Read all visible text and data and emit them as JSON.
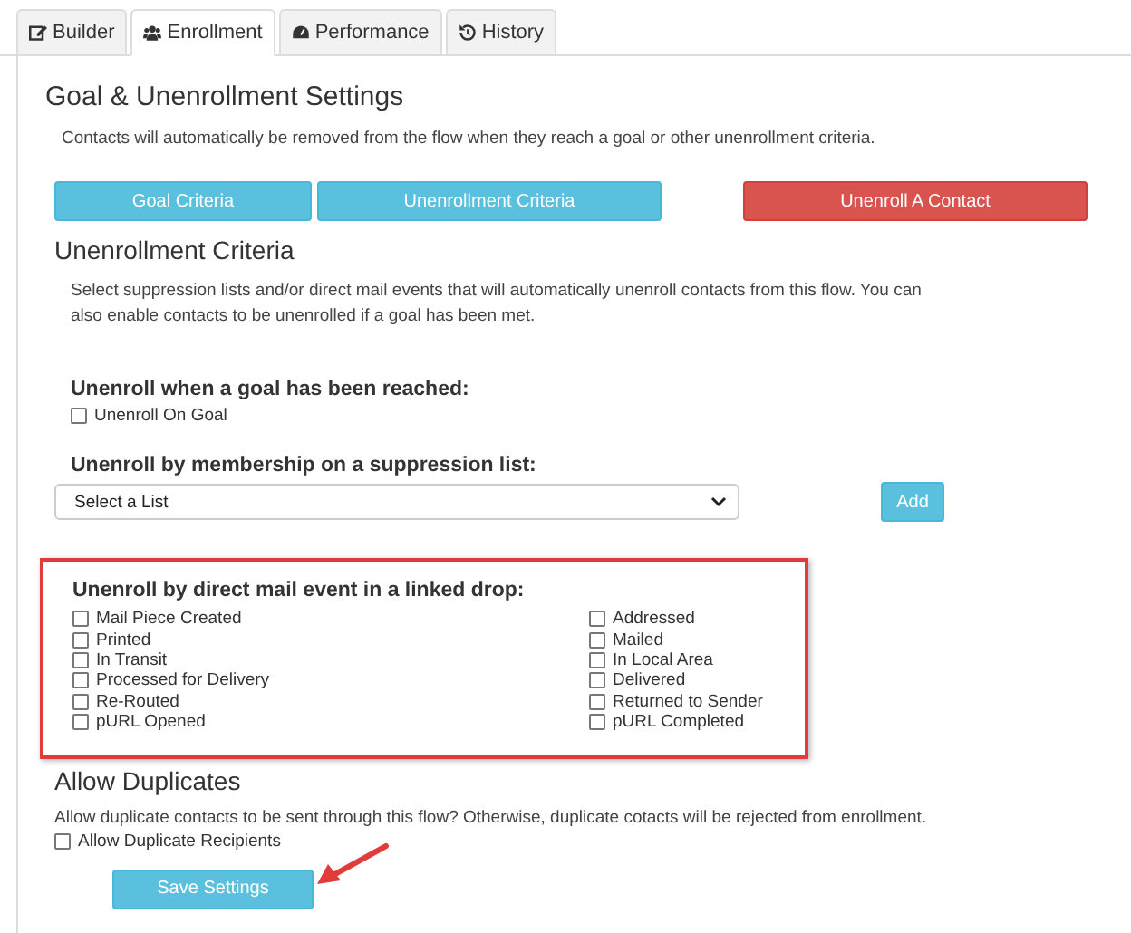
{
  "tabs": [
    {
      "label": "Builder",
      "selected": false
    },
    {
      "label": "Enrollment",
      "selected": true
    },
    {
      "label": "Performance",
      "selected": false
    },
    {
      "label": "History",
      "selected": false
    }
  ],
  "settings": {
    "title": "Goal & Unenrollment Settings",
    "description": "Contacts will automatically be removed from the flow when they reach a goal or other unenrollment criteria.",
    "buttons": [
      {
        "label": "Goal Criteria",
        "kind": "info"
      },
      {
        "label": "Unenrollment Criteria",
        "kind": "info"
      },
      {
        "label": "Unenroll A Contact",
        "kind": "danger"
      }
    ]
  },
  "unenrollment": {
    "title": "Unenrollment Criteria",
    "description": "Select suppression lists and/or direct mail events that will automatically unenroll contacts from this flow. You can also enable contacts to be unenrolled if a goal has been met.",
    "goal": {
      "heading": "Unenroll when a goal has been reached:",
      "option": {
        "label": "Unenroll On Goal",
        "checked": false
      }
    },
    "suppression": {
      "heading": "Unenroll by membership on a suppression list:",
      "select_value": "Select a List",
      "button": "Add"
    },
    "mail_events": {
      "heading": "Unenroll by direct mail event in a linked drop:",
      "highlighted": true,
      "left": [
        {
          "label": "Mail Piece Created",
          "checked": false
        },
        {
          "label": "Printed",
          "checked": false
        },
        {
          "label": "In Transit",
          "checked": false
        },
        {
          "label": "Processed for Delivery",
          "checked": false
        },
        {
          "label": "Re-Routed",
          "checked": false
        },
        {
          "label": "pURL Opened",
          "checked": false
        }
      ],
      "right": [
        {
          "label": "Addressed",
          "checked": false
        },
        {
          "label": "Mailed",
          "checked": false
        },
        {
          "label": "In Local Area",
          "checked": false
        },
        {
          "label": "Delivered",
          "checked": false
        },
        {
          "label": "Returned to Sender",
          "checked": false
        },
        {
          "label": "pURL Completed",
          "checked": false
        }
      ]
    }
  },
  "duplicates": {
    "title": "Allow Duplicates",
    "description": "Allow duplicate contacts to be sent through this flow? Otherwise, duplicate cotacts will be rejected from enrollment.",
    "option": {
      "label": "Allow Duplicate Recipients",
      "checked": false
    },
    "save_button": "Save Settings",
    "pointer_arrow": true
  }
}
